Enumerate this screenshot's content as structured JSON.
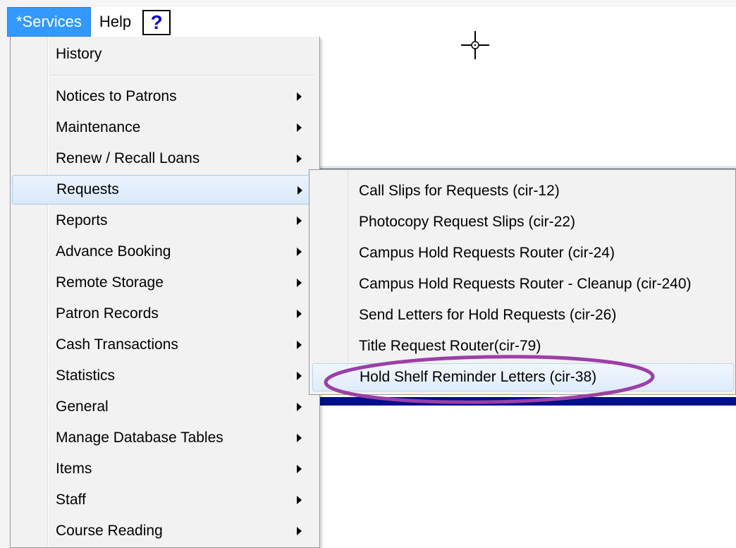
{
  "menubar": {
    "services_label": "*Services",
    "help_label": "Help",
    "help_icon_glyph": "?",
    "active_color": "#3399ff"
  },
  "services_menu": {
    "items": [
      {
        "label": "History",
        "submenu": false
      },
      {
        "label": "Notices to Patrons",
        "submenu": true
      },
      {
        "label": "Maintenance",
        "submenu": true
      },
      {
        "label": "Renew / Recall Loans",
        "submenu": true
      },
      {
        "label": "Requests",
        "submenu": true,
        "highlighted": true
      },
      {
        "label": "Reports",
        "submenu": true
      },
      {
        "label": "Advance Booking",
        "submenu": true
      },
      {
        "label": "Remote Storage",
        "submenu": true
      },
      {
        "label": "Patron Records",
        "submenu": true
      },
      {
        "label": "Cash Transactions",
        "submenu": true
      },
      {
        "label": "Statistics",
        "submenu": true
      },
      {
        "label": "General",
        "submenu": true
      },
      {
        "label": "Manage Database Tables",
        "submenu": true
      },
      {
        "label": "Items",
        "submenu": true
      },
      {
        "label": "Staff",
        "submenu": true
      },
      {
        "label": "Course Reading",
        "submenu": true
      }
    ]
  },
  "requests_submenu": {
    "items": [
      {
        "label": "Call Slips for Requests (cir-12)"
      },
      {
        "label": "Photocopy Request Slips (cir-22)"
      },
      {
        "label": "Campus Hold Requests Router (cir-24)"
      },
      {
        "label": "Campus Hold Requests Router - Cleanup (cir-240)"
      },
      {
        "label": "Send Letters for Hold Requests (cir-26)"
      },
      {
        "label": "Title Request Router(cir-79)"
      },
      {
        "label": "Hold Shelf Reminder Letters (cir-38)",
        "highlighted": true,
        "circled": true
      }
    ]
  },
  "colors": {
    "highlight_border": "#a8cbef",
    "annotation_circle": "#9b3fa8",
    "status_band": "#000f8a"
  }
}
